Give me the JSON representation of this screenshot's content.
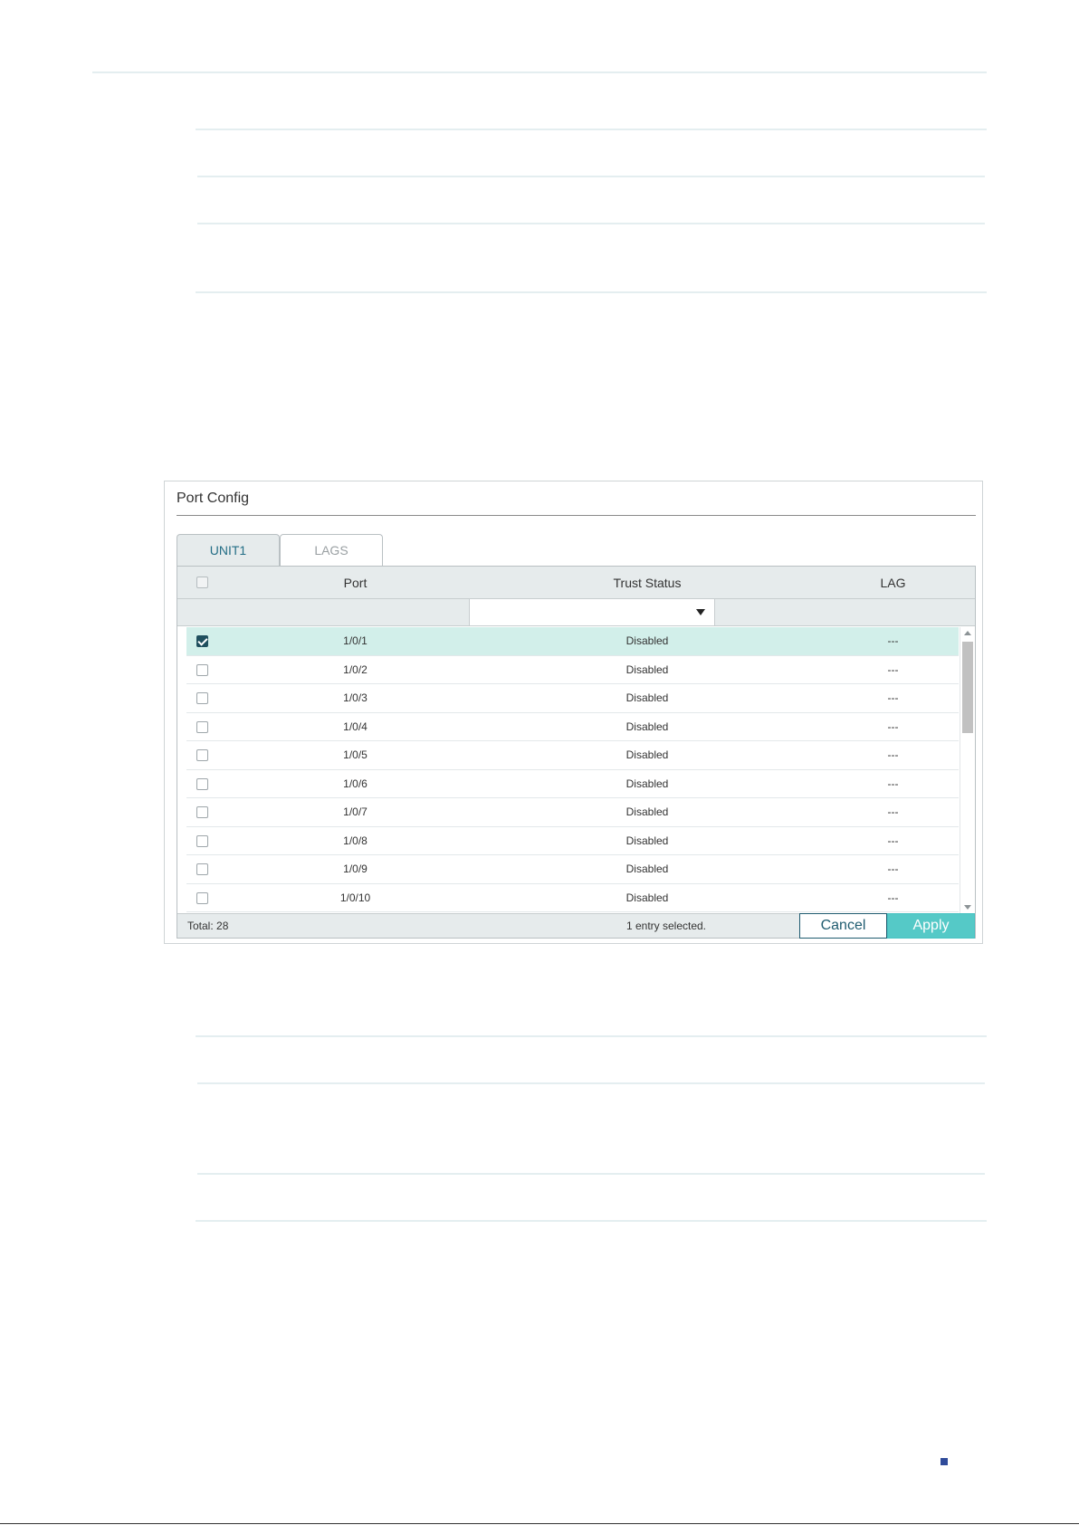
{
  "panel": {
    "title": "Port Config"
  },
  "tabs": [
    {
      "label": "UNIT1",
      "active": true
    },
    {
      "label": "LAGS",
      "active": false
    }
  ],
  "table": {
    "columns": [
      "Port",
      "Trust Status",
      "LAG"
    ],
    "rows": [
      {
        "port": "1/0/1",
        "trust_status": "Disabled",
        "lag": "---",
        "checked": true
      },
      {
        "port": "1/0/2",
        "trust_status": "Disabled",
        "lag": "---",
        "checked": false
      },
      {
        "port": "1/0/3",
        "trust_status": "Disabled",
        "lag": "---",
        "checked": false
      },
      {
        "port": "1/0/4",
        "trust_status": "Disabled",
        "lag": "---",
        "checked": false
      },
      {
        "port": "1/0/5",
        "trust_status": "Disabled",
        "lag": "---",
        "checked": false
      },
      {
        "port": "1/0/6",
        "trust_status": "Disabled",
        "lag": "---",
        "checked": false
      },
      {
        "port": "1/0/7",
        "trust_status": "Disabled",
        "lag": "---",
        "checked": false
      },
      {
        "port": "1/0/8",
        "trust_status": "Disabled",
        "lag": "---",
        "checked": false
      },
      {
        "port": "1/0/9",
        "trust_status": "Disabled",
        "lag": "---",
        "checked": false
      },
      {
        "port": "1/0/10",
        "trust_status": "Disabled",
        "lag": "---",
        "checked": false
      }
    ]
  },
  "footer": {
    "total": "Total: 28",
    "selected": "1 entry selected.",
    "cancel_label": "Cancel",
    "apply_label": "Apply"
  },
  "colors": {
    "accent": "#55c9c7",
    "selected_row": "#d2efea",
    "active_tab_text": "#246e86",
    "page_marker": "#2f4b9a"
  },
  "icons": {
    "dropdown": "caret-down-icon",
    "checkbox": "checkbox-icon",
    "scroll_up": "scroll-up-arrow-icon",
    "scroll_down": "scroll-down-arrow-icon"
  }
}
